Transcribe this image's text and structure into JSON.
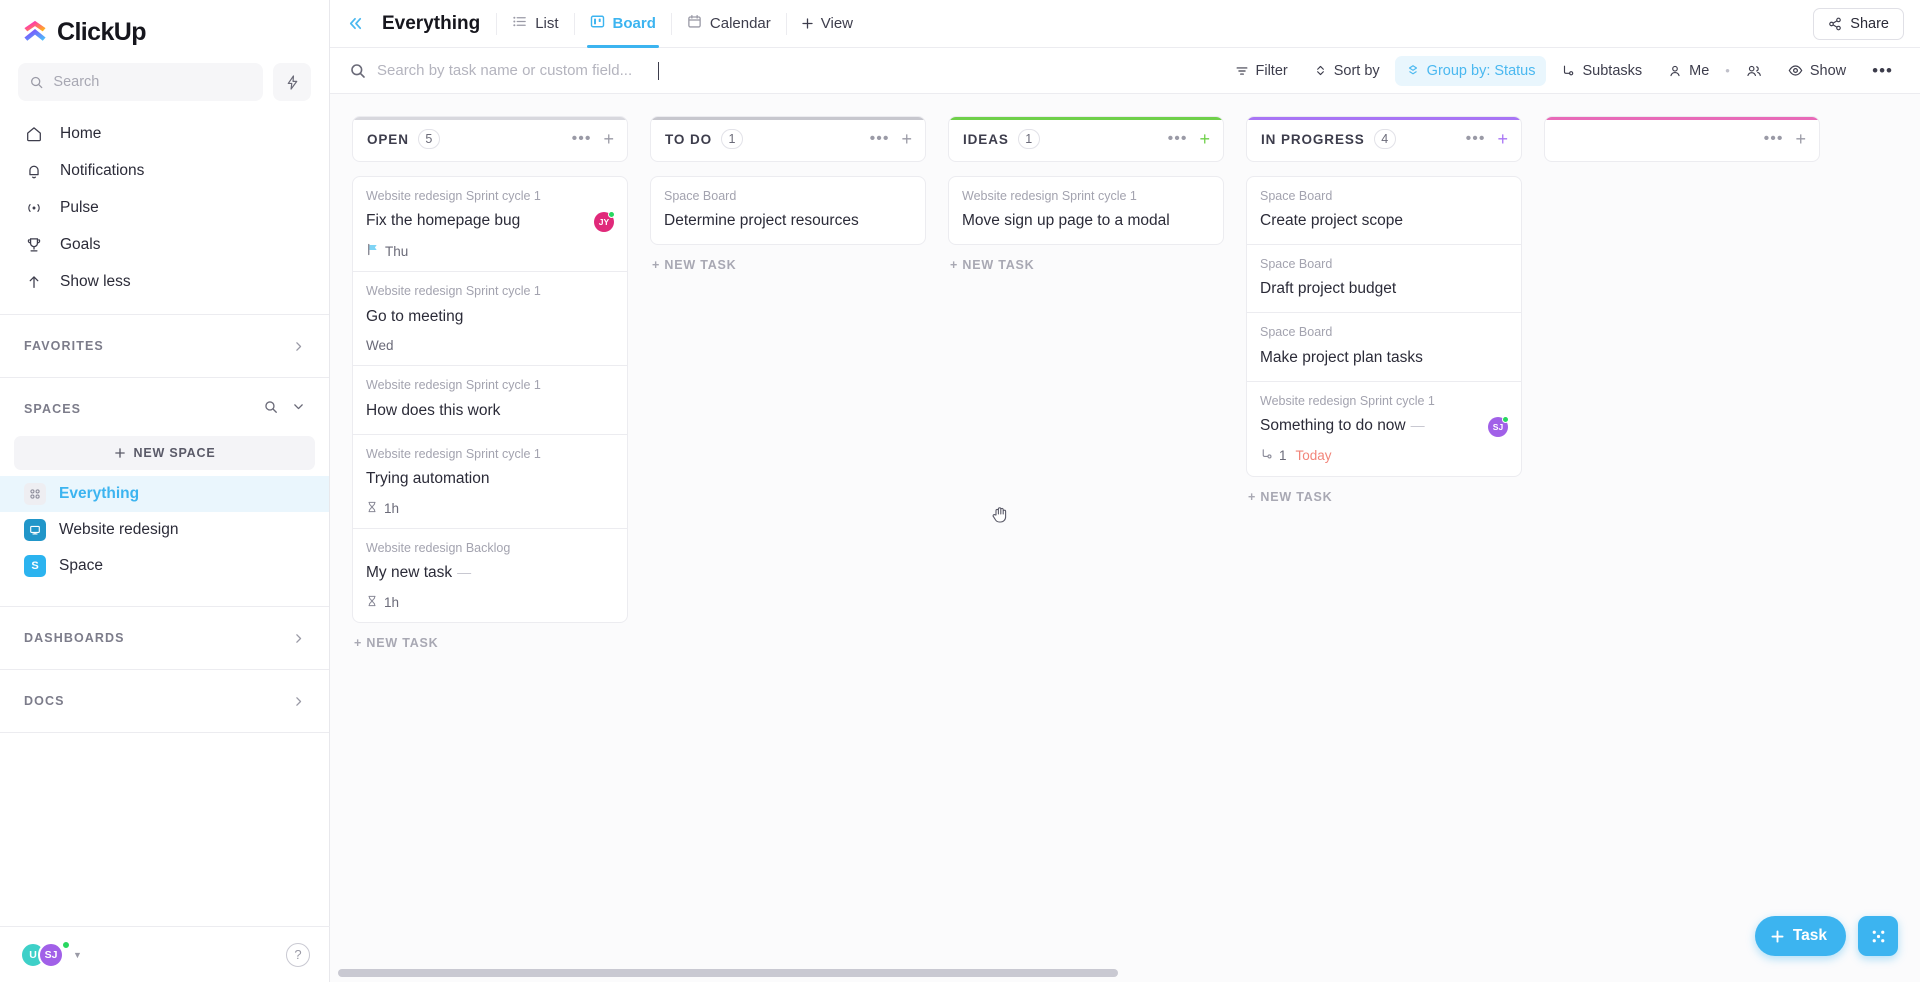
{
  "brand": {
    "name": "ClickUp",
    "accent": "#3cb4f0"
  },
  "sidebar": {
    "search": {
      "placeholder": "Search",
      "value": ""
    },
    "nav": [
      {
        "label": "Home",
        "icon": "home-icon"
      },
      {
        "label": "Notifications",
        "icon": "bell-icon"
      },
      {
        "label": "Pulse",
        "icon": "pulse-icon"
      },
      {
        "label": "Goals",
        "icon": "trophy-icon"
      },
      {
        "label": "Show less",
        "icon": "arrow-up-icon"
      }
    ],
    "sections": {
      "favorites": "FAVORITES",
      "spaces": "SPACES",
      "dashboards": "DASHBOARDS",
      "docs": "DOCS"
    },
    "new_space": "NEW SPACE",
    "spaces": [
      {
        "label": "Everything",
        "icon": "grid-icon",
        "color": "#eeeef2",
        "active": true
      },
      {
        "label": "Website redesign",
        "icon": "monitor-icon",
        "color": "#2196c9",
        "active": false
      },
      {
        "label": "Space",
        "initial": "S",
        "color": "#2bb3ef",
        "active": false
      }
    ],
    "footer": {
      "avatars": [
        {
          "initials": "U",
          "color": "#3ed0c8"
        },
        {
          "initials": "SJ",
          "color": "#a160e8"
        }
      ],
      "help": "?"
    }
  },
  "header": {
    "title": "Everything",
    "tabs": [
      {
        "label": "List",
        "icon": "list-icon",
        "active": false
      },
      {
        "label": "Board",
        "icon": "board-icon",
        "active": true
      },
      {
        "label": "Calendar",
        "icon": "calendar-icon",
        "active": false
      }
    ],
    "add_view": "View",
    "share": "Share"
  },
  "toolbar": {
    "search_placeholder": "Search by task name or custom field...",
    "search_value": "",
    "filter": "Filter",
    "sort": "Sort by",
    "group": "Group by: Status",
    "subtasks": "Subtasks",
    "me": "Me",
    "show": "Show",
    "more": "•••"
  },
  "board": {
    "new_task_label": "+ NEW TASK",
    "columns": [
      {
        "title": "OPEN",
        "count": "5",
        "accent": "#d8d8de",
        "plus_color": "#9a9aa6",
        "show_new_task": true,
        "cards": [
          {
            "list": "Website redesign Sprint cycle 1",
            "title": "Fix the homepage bug",
            "avatar": {
              "initials": "JY",
              "color": "#e0297a",
              "online": true
            },
            "meta": [
              {
                "type": "flag",
                "text": "Thu",
                "color": "#6a6a78"
              }
            ]
          },
          {
            "list": "Website redesign Sprint cycle 1",
            "title": "Go to meeting",
            "meta": [
              {
                "type": "date",
                "text": "Wed",
                "color": "#6a6a78"
              }
            ]
          },
          {
            "list": "Website redesign Sprint cycle 1",
            "title": "How does this work",
            "meta": []
          },
          {
            "list": "Website redesign Sprint cycle 1",
            "title": "Trying automation",
            "meta": [
              {
                "type": "time",
                "text": "1h",
                "color": "#6a6a78"
              }
            ]
          },
          {
            "list": "Website redesign Backlog",
            "title": "My new task",
            "dash": true,
            "meta": [
              {
                "type": "time",
                "text": "1h",
                "color": "#6a6a78"
              }
            ]
          }
        ]
      },
      {
        "title": "TO DO",
        "count": "1",
        "accent": "#c7c7ce",
        "plus_color": "#9a9aa6",
        "show_new_task": true,
        "cards": [
          {
            "list": "Space Board",
            "title": "Determine project resources",
            "meta": []
          }
        ]
      },
      {
        "title": "IDEAS",
        "count": "1",
        "accent": "#6fd04a",
        "plus_color": "#6fd04a",
        "show_new_task": true,
        "cards": [
          {
            "list": "Website redesign Sprint cycle 1",
            "title": "Move sign up page to a modal",
            "meta": []
          }
        ]
      },
      {
        "title": "IN PROGRESS",
        "count": "4",
        "accent": "#a875f5",
        "plus_color": "#a875f5",
        "show_new_task": true,
        "cards": [
          {
            "list": "Space Board",
            "title": "Create project scope",
            "meta": []
          },
          {
            "list": "Space Board",
            "title": "Draft project budget",
            "meta": []
          },
          {
            "list": "Space Board",
            "title": "Make project plan tasks",
            "meta": []
          },
          {
            "list": "Website redesign Sprint cycle 1",
            "title": "Something to do now",
            "dash": true,
            "avatar": {
              "initials": "SJ",
              "color": "#a160e8",
              "online": true
            },
            "meta": [
              {
                "type": "subtask",
                "text": "1",
                "color": "#6a6a78"
              },
              {
                "type": "date",
                "text": "Today",
                "color": "#f2857a"
              }
            ]
          }
        ]
      },
      {
        "title": "",
        "count": "",
        "accent": "#e86ab8",
        "plus_color": "#9a9aa6",
        "show_new_task": false,
        "partial": true,
        "cards": []
      }
    ]
  },
  "fab": {
    "task": "Task"
  }
}
